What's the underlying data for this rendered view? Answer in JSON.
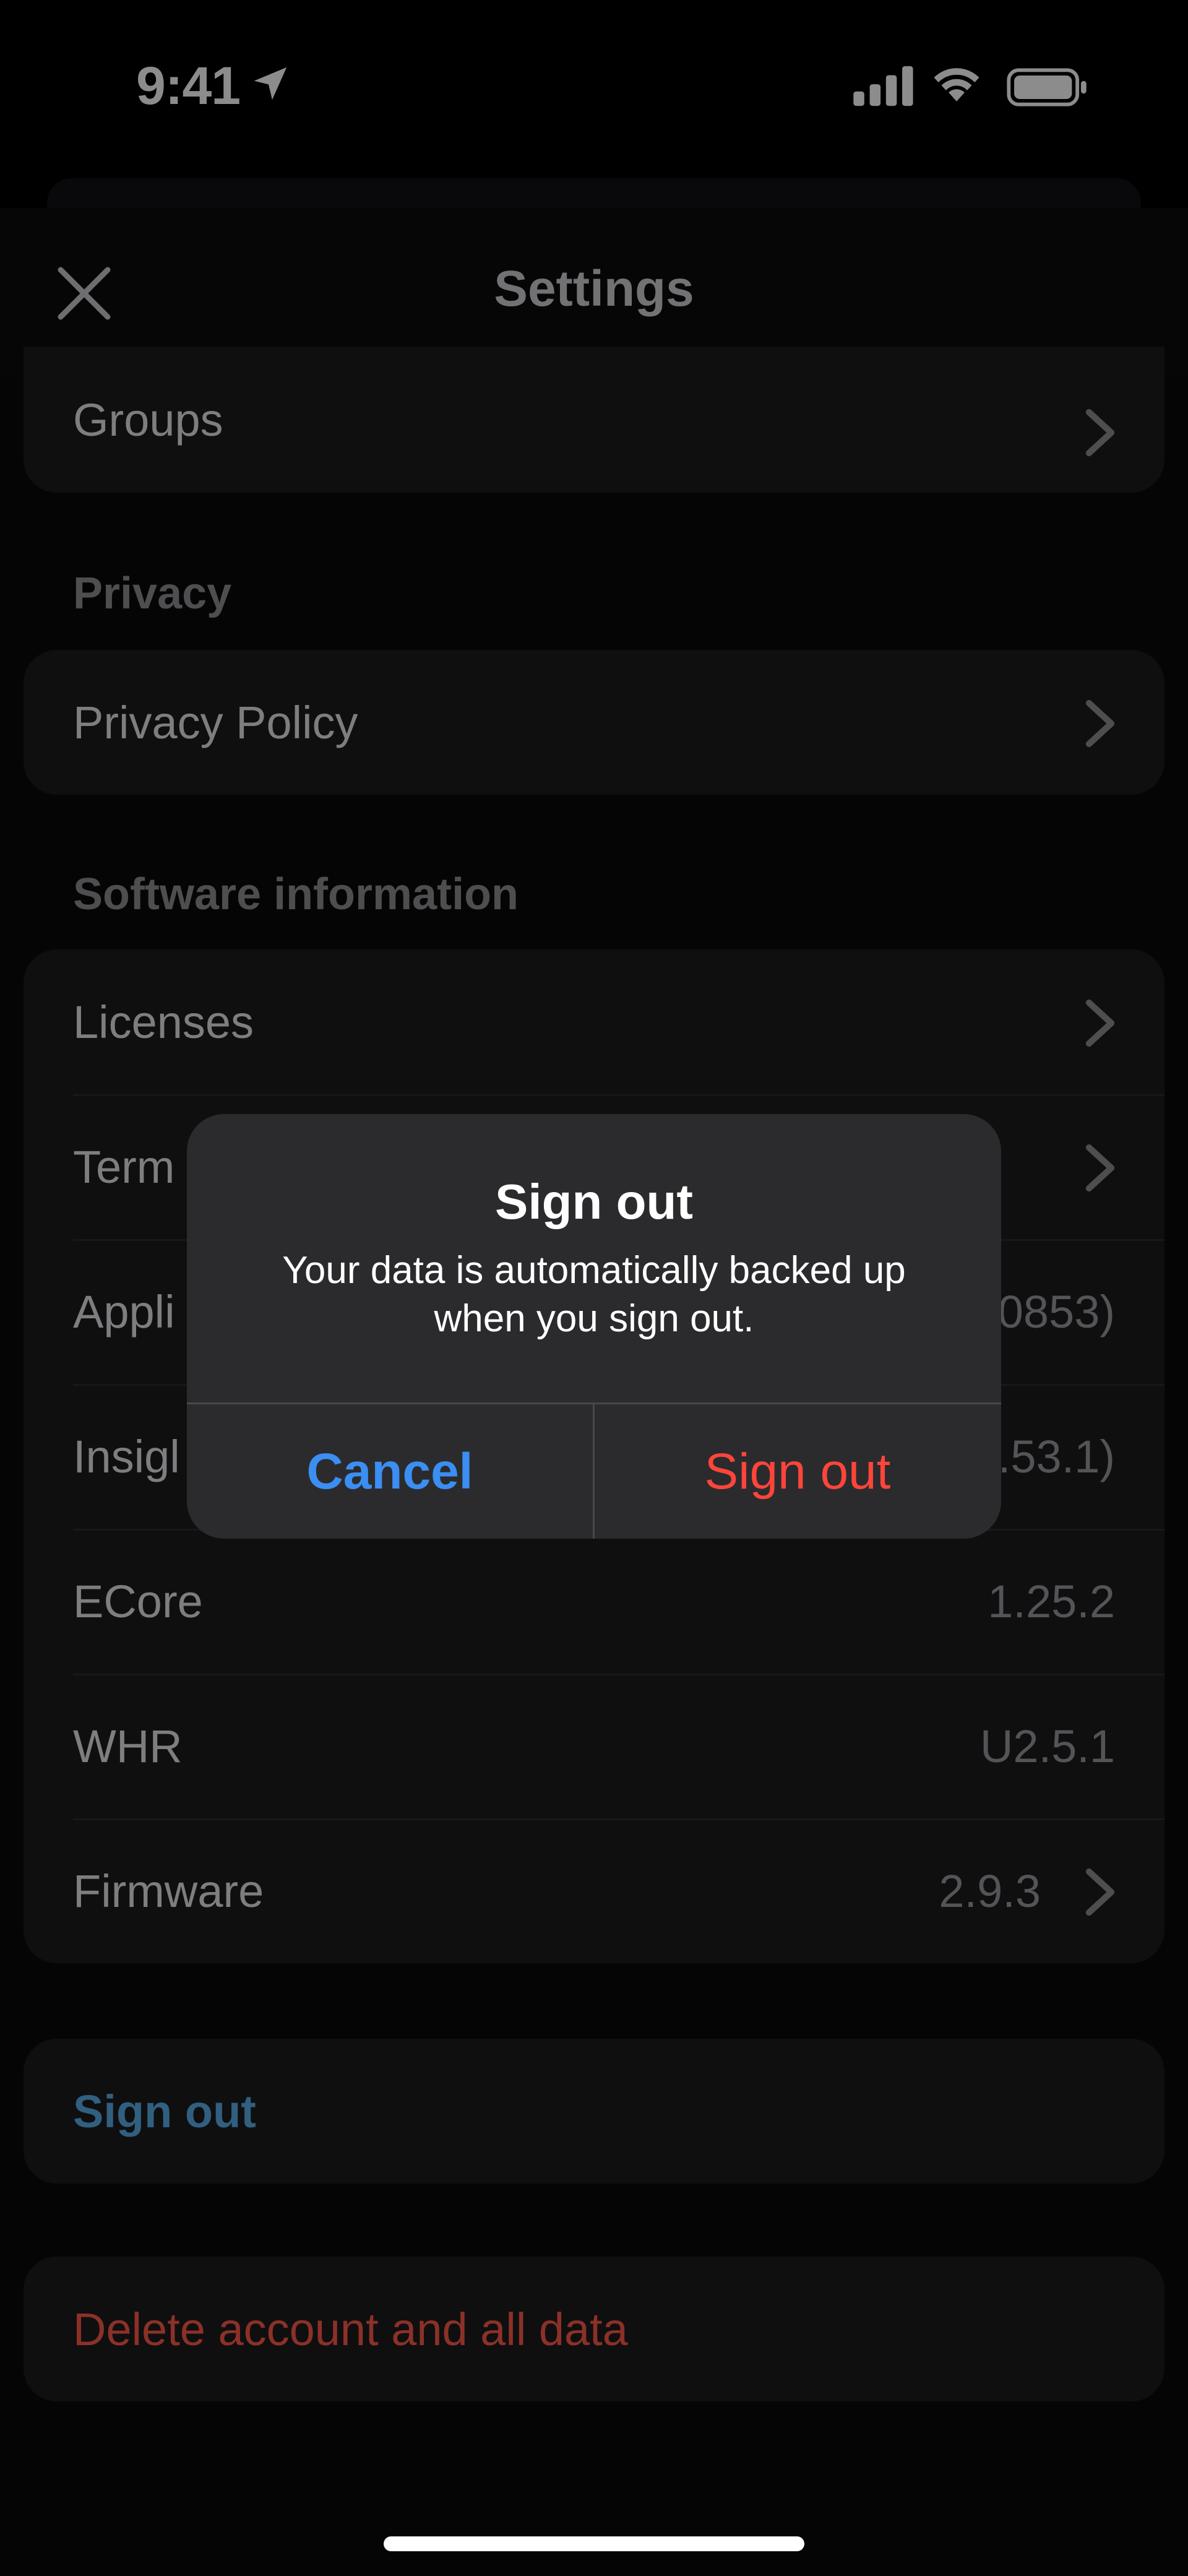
{
  "status_bar": {
    "time": "9:41"
  },
  "header": {
    "title": "Settings"
  },
  "top_card": {
    "groups_label": "Groups"
  },
  "privacy": {
    "header": "Privacy",
    "items": [
      {
        "label": "Privacy Policy"
      }
    ]
  },
  "software": {
    "header": "Software information",
    "items": [
      {
        "label": "Licenses",
        "value": ""
      },
      {
        "label": "Term",
        "value": ""
      },
      {
        "label": "Appli",
        "value": "0853)"
      },
      {
        "label": "Insigl",
        "value": ".53.1)"
      },
      {
        "label": "ECore",
        "value": "1.25.2"
      },
      {
        "label": "WHR",
        "value": "U2.5.1"
      },
      {
        "label": "Firmware",
        "value": "2.9.3"
      }
    ]
  },
  "actions": {
    "sign_out": "Sign out",
    "delete": "Delete account and all data"
  },
  "alert": {
    "title": "Sign out",
    "message": "Your data is automatically backed up when you sign out.",
    "cancel": "Cancel",
    "confirm": "Sign out"
  },
  "colors": {
    "accent_blue": "#3b8ef2",
    "destructive_red": "#ff453a",
    "signout_link": "#5aaeea"
  },
  "icons": [
    "location-arrow-icon",
    "cellular-signal-icon",
    "wifi-icon",
    "battery-icon",
    "close-icon",
    "chevron-right-icon"
  ]
}
